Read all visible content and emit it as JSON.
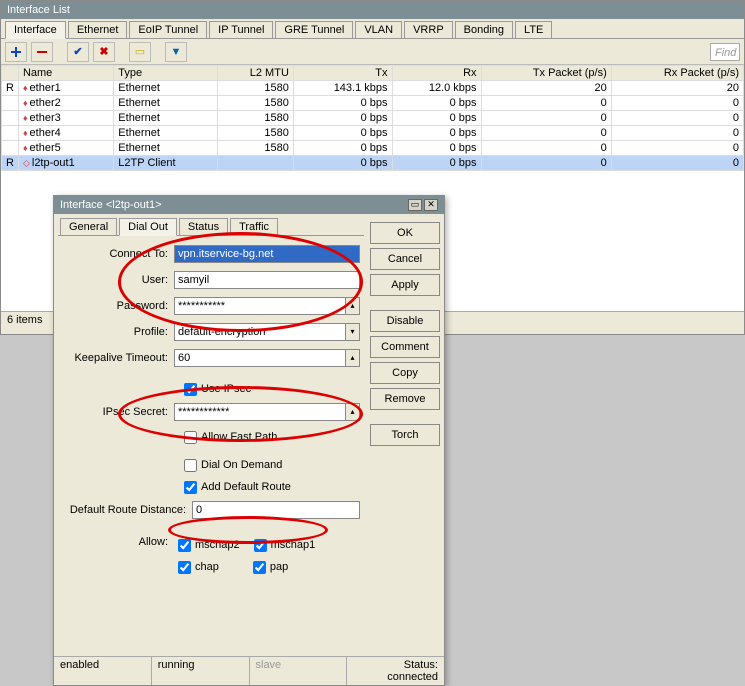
{
  "main": {
    "title": "Interface List",
    "tabs": [
      "Interface",
      "Ethernet",
      "EoIP Tunnel",
      "IP Tunnel",
      "GRE Tunnel",
      "VLAN",
      "VRRP",
      "Bonding",
      "LTE"
    ],
    "active_tab": 0,
    "find_placeholder": "Find",
    "columns": [
      "",
      "Name",
      "Type",
      "L2 MTU",
      "Tx",
      "Rx",
      "Tx Packet (p/s)",
      "Rx Packet (p/s)"
    ],
    "rows": [
      {
        "flag": "R",
        "name": "ether1",
        "type": "Ethernet",
        "l2mtu": "1580",
        "tx": "143.1 kbps",
        "rx": "12.0 kbps",
        "txp": "20",
        "rxp": "20"
      },
      {
        "flag": "",
        "name": "ether2",
        "type": "Ethernet",
        "l2mtu": "1580",
        "tx": "0 bps",
        "rx": "0 bps",
        "txp": "0",
        "rxp": "0"
      },
      {
        "flag": "",
        "name": "ether3",
        "type": "Ethernet",
        "l2mtu": "1580",
        "tx": "0 bps",
        "rx": "0 bps",
        "txp": "0",
        "rxp": "0"
      },
      {
        "flag": "",
        "name": "ether4",
        "type": "Ethernet",
        "l2mtu": "1580",
        "tx": "0 bps",
        "rx": "0 bps",
        "txp": "0",
        "rxp": "0"
      },
      {
        "flag": "",
        "name": "ether5",
        "type": "Ethernet",
        "l2mtu": "1580",
        "tx": "0 bps",
        "rx": "0 bps",
        "txp": "0",
        "rxp": "0"
      },
      {
        "flag": "R",
        "name": "l2tp-out1",
        "type": "L2TP Client",
        "l2mtu": "",
        "tx": "0 bps",
        "rx": "0 bps",
        "txp": "0",
        "rxp": "0",
        "sel": true,
        "dyn": true
      }
    ],
    "status": "6 items"
  },
  "dialog": {
    "title": "Interface <l2tp-out1>",
    "tabs": [
      "General",
      "Dial Out",
      "Status",
      "Traffic"
    ],
    "active_tab": 1,
    "fields": {
      "connect_to_label": "Connect To:",
      "connect_to": "vpn.itservice-bg.net",
      "user_label": "User:",
      "user": "samyil",
      "password_label": "Password:",
      "password": "***********",
      "profile_label": "Profile:",
      "profile": "default-encryption",
      "keepalive_label": "Keepalive Timeout:",
      "keepalive": "60",
      "use_ipsec_label": "Use IPsec",
      "ipsec_secret_label": "IPsec Secret:",
      "ipsec_secret": "************",
      "allow_fastpath_label": "Allow Fast Path",
      "dial_on_demand_label": "Dial On Demand",
      "add_default_route_label": "Add Default Route",
      "default_route_dist_label": "Default Route Distance:",
      "default_route_dist": "0",
      "allow_label": "Allow:",
      "mschap2": "mschap2",
      "mschap1": "mschap1",
      "chap": "chap",
      "pap": "pap"
    },
    "buttons": {
      "ok": "OK",
      "cancel": "Cancel",
      "apply": "Apply",
      "disable": "Disable",
      "comment": "Comment",
      "copy": "Copy",
      "remove": "Remove",
      "torch": "Torch"
    },
    "status": {
      "enabled": "enabled",
      "running": "running",
      "slave": "slave",
      "connected": "Status: connected"
    }
  }
}
